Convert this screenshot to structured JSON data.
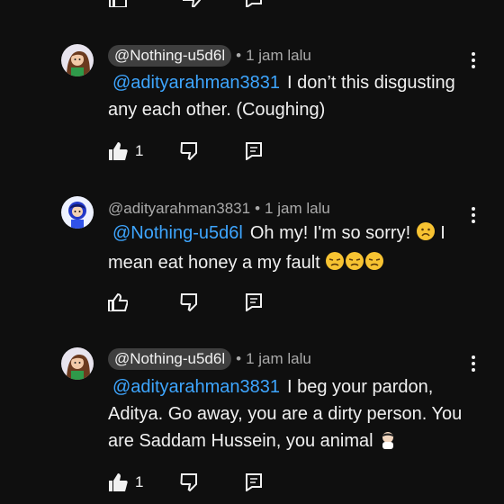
{
  "comments": [
    {
      "author": "@Nothing-u5d6l",
      "author_style": "pill",
      "time": "1 jam lalu",
      "mention": "@adityarahman3831",
      "text": "I don’t this disgusting any each other. (Coughing)",
      "text_line2": "",
      "emoji_tail": "",
      "likes": "1",
      "liked": true,
      "avatar": "girl-avatar"
    },
    {
      "author": "@adityarahman3831",
      "author_style": "plain",
      "time": "1 jam lalu",
      "mention": "@Nothing-u5d6l",
      "text": "Oh my! I'm so sorry!",
      "text_line2": "I mean eat honey a my fault",
      "emoji_tail": "😞😞😞",
      "likes": "",
      "liked": false,
      "avatar": "blue-character-avatar"
    },
    {
      "author": "@Nothing-u5d6l",
      "author_style": "pill",
      "time": "1 jam lalu",
      "mention": "@adityarahman3831",
      "text": "I beg your pardon, Aditya. Go away, you are a dirty person. You are Saddam Hussein, you animal",
      "text_line2": "",
      "emoji_tail": "🤦‍♀️",
      "likes": "1",
      "liked": true,
      "avatar": "girl-avatar"
    }
  ],
  "colors": {
    "background": "#0f0f0f",
    "mention": "#3ea6ff",
    "pill": "#3f3f3f",
    "meta": "#aaaaaa"
  }
}
